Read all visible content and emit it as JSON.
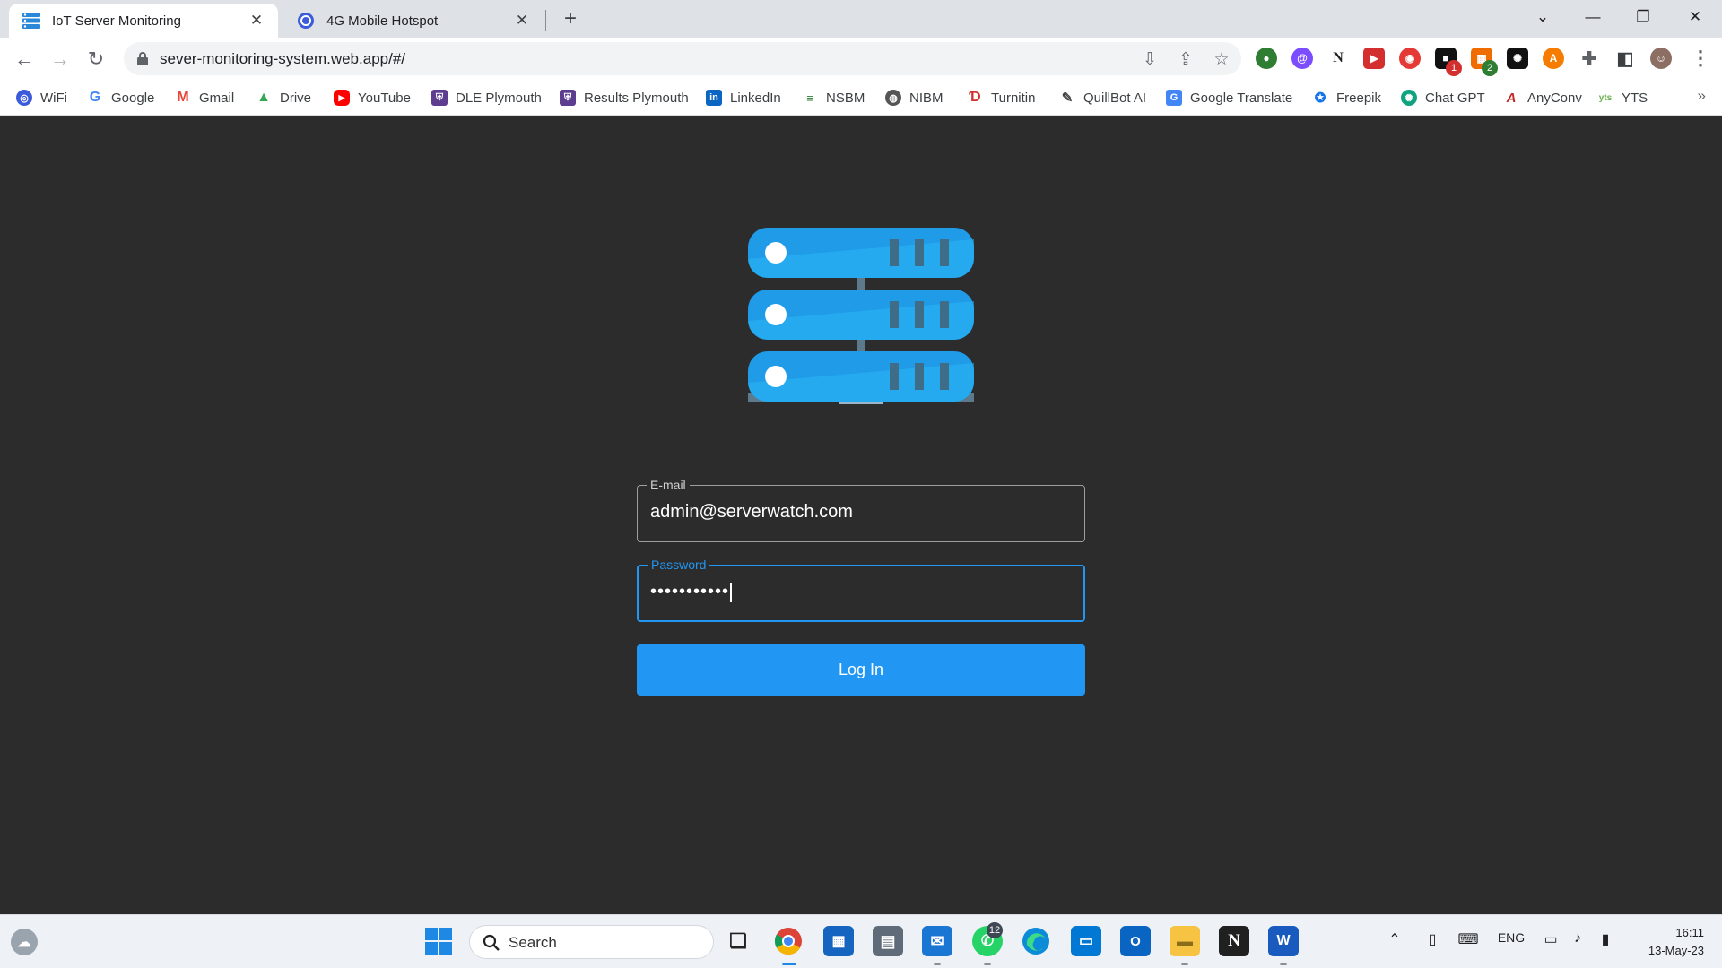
{
  "browser": {
    "tabs": [
      {
        "title": "IoT Server Monitoring",
        "active": true
      },
      {
        "title": "4G Mobile Hotspot",
        "active": false
      }
    ],
    "url": "sever-monitoring-system.web.app/#/",
    "bookmarks": [
      {
        "label": "WiFi",
        "icon": "wifi-icon",
        "color": "#3b5bdb"
      },
      {
        "label": "Google",
        "icon": "google-icon",
        "color": "#4285f4"
      },
      {
        "label": "Gmail",
        "icon": "gmail-icon",
        "color": "#ea4335"
      },
      {
        "label": "Drive",
        "icon": "drive-icon",
        "color": "#34a853"
      },
      {
        "label": "YouTube",
        "icon": "youtube-icon",
        "color": "#ff0000"
      },
      {
        "label": "DLE Plymouth",
        "icon": "shield-icon",
        "color": "#5c3d8f"
      },
      {
        "label": "Results Plymouth",
        "icon": "shield-icon",
        "color": "#5c3d8f"
      },
      {
        "label": "LinkedIn",
        "icon": "linkedin-icon",
        "color": "#0a66c2"
      },
      {
        "label": "NSBM",
        "icon": "nsbm-icon",
        "color": "#2e7d32"
      },
      {
        "label": "NIBM",
        "icon": "globe-icon",
        "color": "#555555"
      },
      {
        "label": "Turnitin",
        "icon": "turnitin-icon",
        "color": "#d32f2f"
      },
      {
        "label": "QuillBot AI",
        "icon": "feather-icon",
        "color": "#444444"
      },
      {
        "label": "Google Translate",
        "icon": "translate-icon",
        "color": "#4285f4"
      },
      {
        "label": "Freepik",
        "icon": "freepik-icon",
        "color": "#1273eb"
      },
      {
        "label": "Chat GPT",
        "icon": "chatgpt-icon",
        "color": "#10a37f"
      },
      {
        "label": "AnyConv",
        "icon": "anyconv-icon",
        "color": "#c62828"
      },
      {
        "label": "YTS",
        "icon": "yts-icon",
        "color": "#6ab04c"
      }
    ],
    "extension_badges": {
      "first": "1",
      "second": "2"
    }
  },
  "login": {
    "email_label": "E-mail",
    "email_value": "admin@serverwatch.com",
    "password_label": "Password",
    "password_value": "•••••••••••",
    "login_button": "Log In"
  },
  "colors": {
    "page_background": "#2c2c2c",
    "accent": "#2196f3",
    "server_blue": "#29a8f5",
    "server_stand": "#5d7a8c"
  },
  "taskbar": {
    "search_label": "Search",
    "whatsapp_badge": "12",
    "language": "ENG",
    "time": "16:11",
    "date": "13-May-23"
  }
}
